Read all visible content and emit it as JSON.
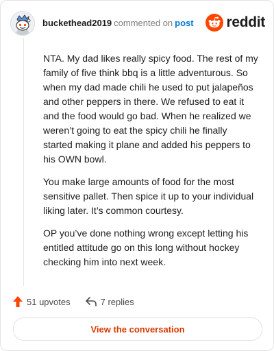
{
  "header": {
    "username": "buckethead2019",
    "action_text": "commented on",
    "post_link": "post",
    "logo_text": "reddit"
  },
  "comment": {
    "paragraphs": [
      "NTA. My dad likes really spicy food. The rest of my family of five think bbq is a little adventurous. So when my dad made chili he used to put jalapeños and other peppers in there. We refused to eat it and the food would go bad. When he realized we weren’t going to eat the spicy chili he finally started making it plane and added his peppers to his OWN bowl.",
      "You make large amounts of food for the most sensitive pallet. Then spice it up to your individual liking later. It’s common courtesy.",
      "OP you’ve done nothing wrong except letting his entitled attitude go on this long without hockey checking him into next week."
    ]
  },
  "footer": {
    "upvotes_label": "51 upvotes",
    "replies_label": "7 replies"
  },
  "cta": {
    "label": "View the conversation"
  },
  "colors": {
    "brand_orange": "#ff4500",
    "link_blue": "#0079d3",
    "cta_text": "#d93a00"
  }
}
